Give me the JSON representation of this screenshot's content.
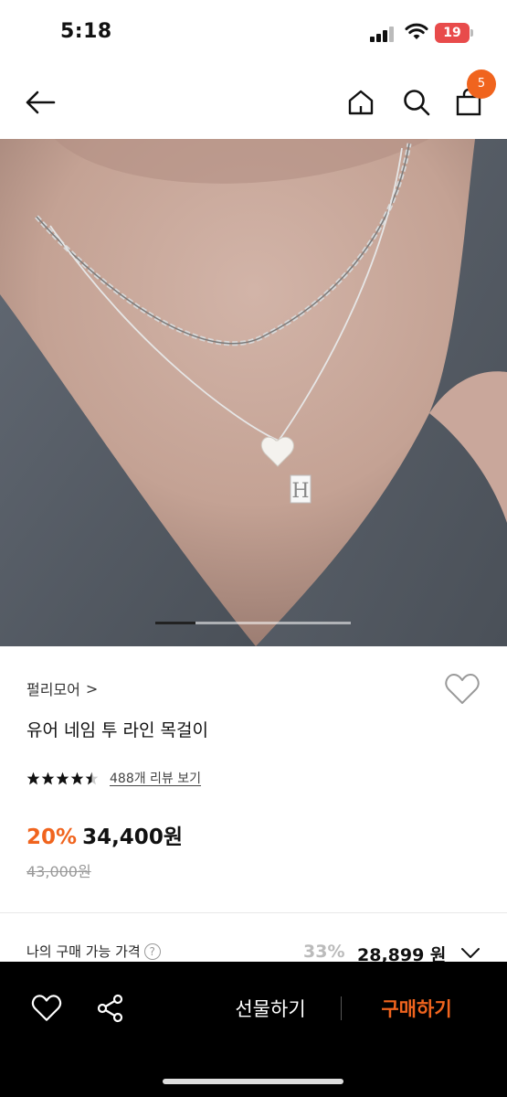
{
  "status_bar": {
    "time": "5:18",
    "battery_level": "19",
    "battery_color": "#e84b4b"
  },
  "nav": {
    "back_icon": "arrow-left-icon",
    "home_icon": "home-icon",
    "search_icon": "search-icon",
    "cart_icon": "cart-icon",
    "cart_badge": "5"
  },
  "product_image": {
    "carousel_position": 1,
    "description_icon": "necklace-photo"
  },
  "product": {
    "brand": "펄리모어",
    "brand_chevron": ">",
    "title": "유어 네임 투 라인 목걸이",
    "rating": 4.5,
    "review_link": "488개 리뷰 보기",
    "discount": "20%",
    "price": "34,400원",
    "original_price": "43,000원"
  },
  "my_price": {
    "label": "나의 구매 가능 가격",
    "help": "?",
    "discount": "33%",
    "price": "28,899 원"
  },
  "bottom_bar": {
    "gift_label": "선물하기",
    "buy_label": "구매하기"
  },
  "colors": {
    "accent": "#f0641e",
    "bottom_bar_bg": "#000000"
  }
}
